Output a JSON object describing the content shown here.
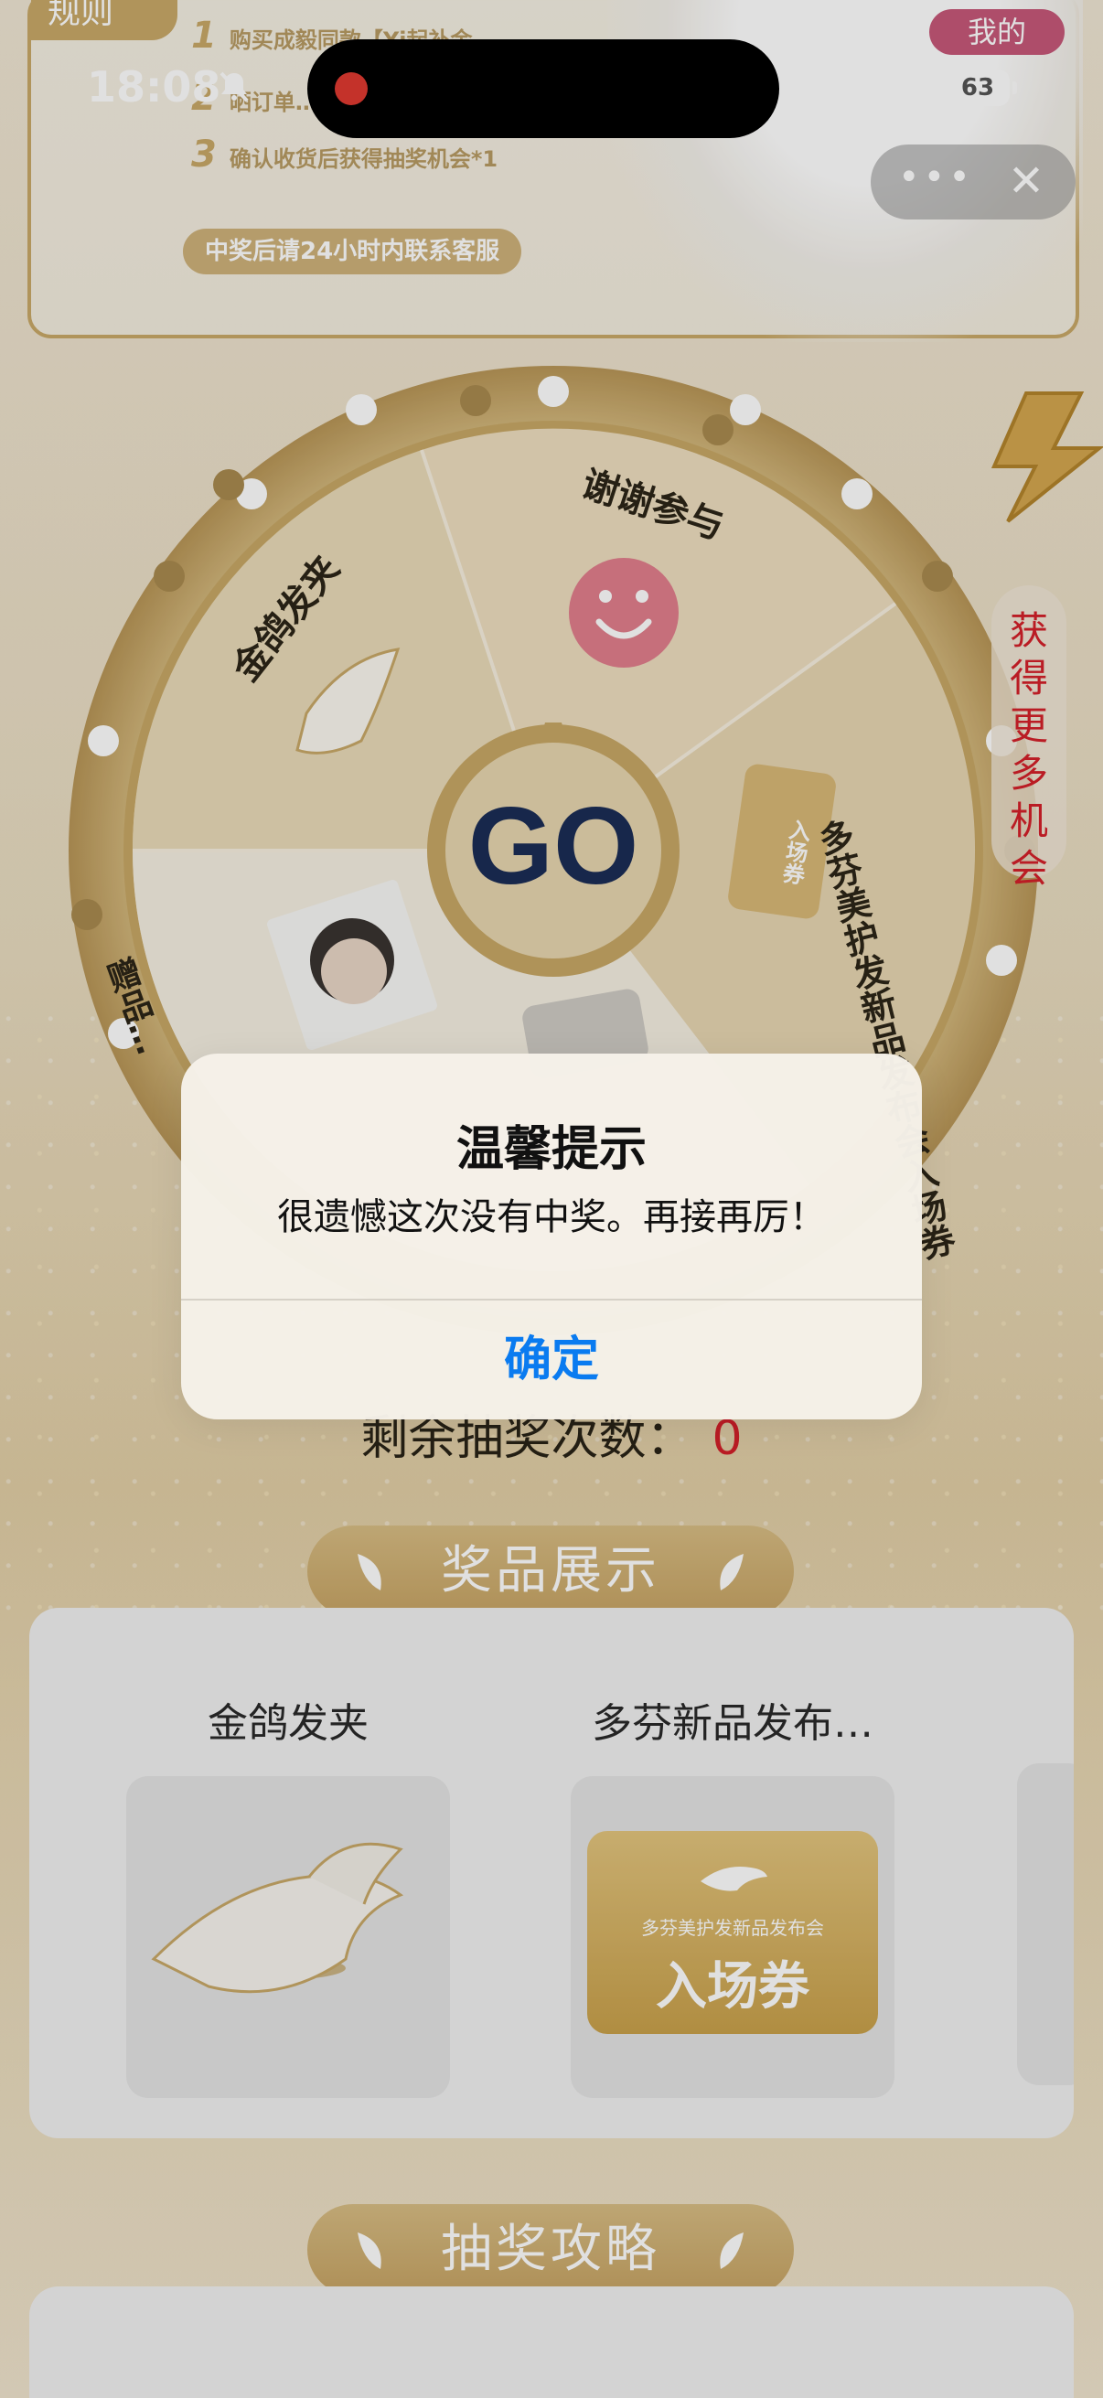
{
  "status_bar": {
    "time": "18:08",
    "battery": "63"
  },
  "mini_program": {
    "more_label": "•••",
    "close_label": "✕"
  },
  "rules": {
    "tag": "规则",
    "my_tag": "我的",
    "steps": [
      {
        "num": "1",
        "text": "购买成毅同款【Yi起补金…"
      },
      {
        "num": "2",
        "text": "晒订单…"
      },
      {
        "num": "3",
        "text": "确认收货后获得抽奖机会*1"
      }
    ],
    "note": "中奖后请24小时内联系客服"
  },
  "wheel": {
    "segments": [
      {
        "label": "谢谢参与"
      },
      {
        "label": "多芬美护发新品发布会入场券"
      },
      {
        "label": "金鸽发夹"
      },
      {
        "label": "赠品…"
      }
    ],
    "go_label": "GO",
    "ticket_mini_label": "入场券"
  },
  "side_button": {
    "label": "获得更多机会"
  },
  "remaining": {
    "label": "剩余抽奖次数：",
    "count": "0"
  },
  "prizes_section": {
    "title": "奖品展示",
    "items": [
      {
        "name": "金鸽发夹"
      },
      {
        "name": "多芬新品发布…",
        "ticket_sub": "多芬美护发新品发布会",
        "ticket_main": "入场券"
      }
    ]
  },
  "strategy_section": {
    "title": "抽奖攻略"
  },
  "alert": {
    "title": "温馨提示",
    "message": "很遗憾这次没有中奖。再接再厉！",
    "confirm": "确定"
  },
  "colors": {
    "gold": "#c9a968",
    "accent_red": "#d4202a",
    "ios_blue": "#0a7bf0",
    "smiley_pink": "#e27f8c",
    "go_navy": "#1b2d56"
  }
}
